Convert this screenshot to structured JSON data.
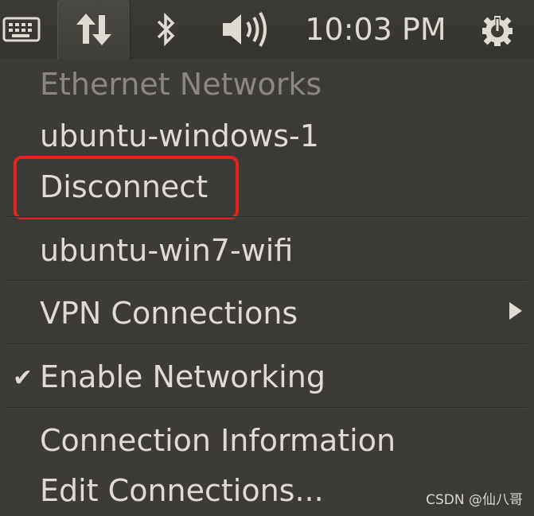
{
  "panel": {
    "icons": [
      "keyboard-icon",
      "network-updown-icon",
      "bluetooth-icon",
      "volume-icon",
      "power-gear-icon"
    ],
    "clock": "10:03 PM"
  },
  "menu": {
    "header": "Ethernet Networks",
    "items": [
      {
        "label": "ubuntu-windows-1"
      },
      {
        "label": "Disconnect"
      },
      {
        "label": "ubuntu-win7-wifi"
      },
      {
        "label": "VPN Connections"
      },
      {
        "label": "Enable Networking"
      },
      {
        "label": "Connection Information"
      },
      {
        "label": "Edit Connections..."
      }
    ]
  },
  "colors": {
    "background": "#3c3b37",
    "text": "#dfdbd2",
    "header_text": "#8a8780",
    "highlight": "#e8231d"
  },
  "watermark": "CSDN @仙八哥"
}
